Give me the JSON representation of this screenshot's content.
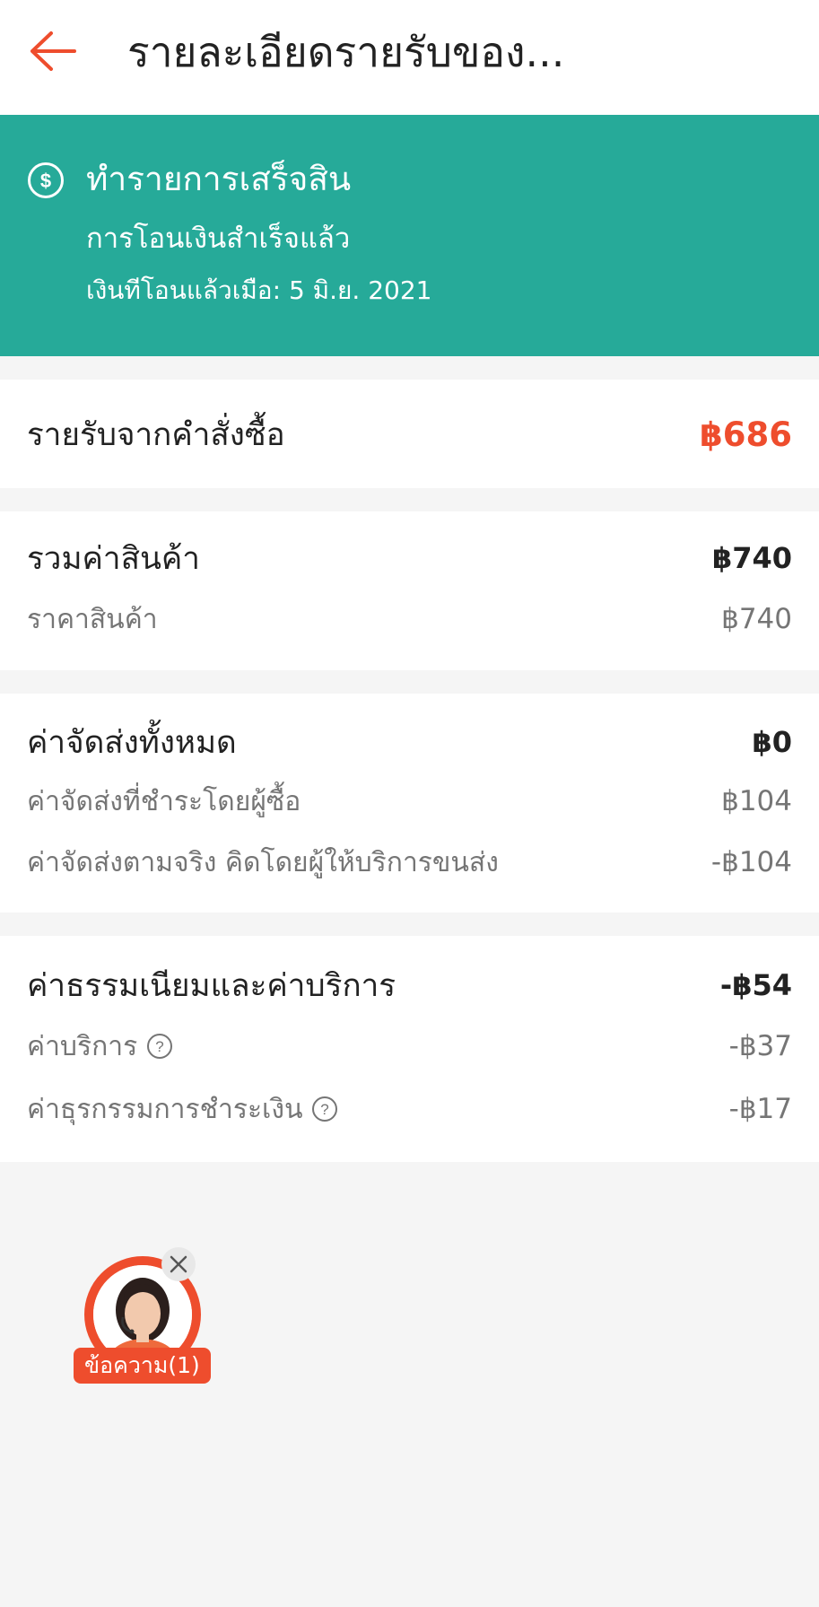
{
  "header": {
    "title": "รายละเอียดรายรับของ...",
    "back_icon": "arrow-left-icon",
    "accent_color": "#ee4d2d"
  },
  "banner": {
    "icon": "dollar-circle-icon",
    "title": "ทำรายการเสร็จสิน",
    "subtitle": "การโอนเงินสำเร็จแล้ว",
    "date_text": "เงินทีโอนแล้วเมือ: 5 มิ.ย. 2021",
    "bg_color": "#26aa99"
  },
  "income": {
    "label": "รายรับจากคำสั่งซื้อ",
    "value": "฿686"
  },
  "products": {
    "label": "รวมค่าสินค้า",
    "value": "฿740",
    "items": [
      {
        "label": "ราคาสินค้า",
        "value": "฿740"
      }
    ]
  },
  "shipping": {
    "label": "ค่าจัดส่งทั้งหมด",
    "value": "฿0",
    "items": [
      {
        "label": "ค่าจัดส่งที่ชำระโดยผู้ซื้อ",
        "value": "฿104"
      },
      {
        "label": "ค่าจัดส่งตามจริง คิดโดยผู้ให้บริการขนส่ง",
        "value": "-฿104"
      }
    ]
  },
  "fees": {
    "label": "ค่าธรรมเนียมและค่าบริการ",
    "value": "-฿54",
    "items": [
      {
        "label": "ค่าบริการ",
        "value": "-฿37",
        "icon": "help-circle-icon"
      },
      {
        "label": "ค่าธุรกรรมการชำระเงิน",
        "value": "-฿17",
        "icon": "help-circle-icon"
      }
    ]
  },
  "chat": {
    "badge": "ข้อความ(1)",
    "close_icon": "close-icon",
    "avatar": "agent-avatar"
  }
}
